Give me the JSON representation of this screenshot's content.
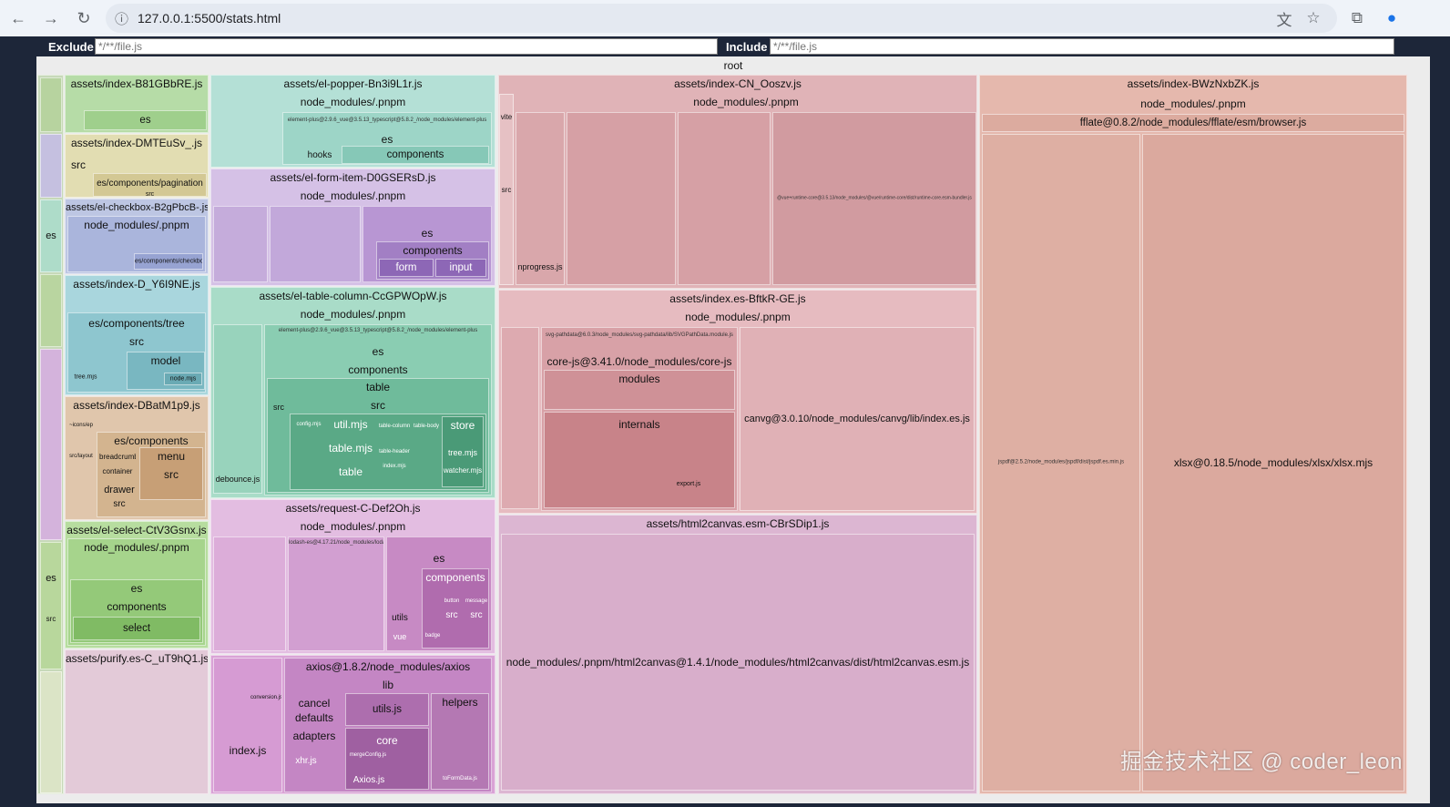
{
  "browser": {
    "url": "127.0.0.1:5500/stats.html",
    "back_icon": "←",
    "forward_icon": "→",
    "reload_icon": "↻",
    "info_icon": "ⓘ",
    "translate_icon": "文",
    "star_icon": "☆",
    "extensions_icon": "⧉",
    "profile_icon": "●"
  },
  "filters": {
    "exclude_label": "Exclude",
    "exclude_placeholder": "*/**/file.js",
    "include_label": "Include",
    "include_placeholder": "*/**/file.js"
  },
  "treemap": {
    "root": "root",
    "col1": {
      "b81": "assets/index-B81GBbRE.js",
      "b81_es": "es",
      "dmt": "assets/index-DMTEuSv_.js",
      "dmt_src": "src",
      "dmt_pag": "es/components/pagination",
      "dmt_pag_src": "src",
      "chk": "assets/el-checkbox-B2gPbcB-.js",
      "chk_nm": "node_modules/.pnpm",
      "chk_es": "es/components/checkbox",
      "chk_left_es": "es",
      "y6": "assets/index-D_Y6I9NE.js",
      "y6_tree": "es/components/tree",
      "y6_src": "src",
      "y6_model": "model",
      "y6_treemjs": "tree.mjs",
      "y6_node": "node.mjs",
      "dbat": "assets/index-DBatM1p9.js",
      "dbat_icons": "~icons/ep",
      "dbat_layout": "src/layout",
      "dbat_comps": "es/components",
      "dbat_bread": "breadcrumb",
      "dbat_menu": "menu",
      "dbat_container": "container",
      "dbat_src": "src",
      "dbat_drawer": "drawer",
      "dbat_drawer_src": "src",
      "sel": "assets/el-select-CtV3Gsnx.js",
      "sel_nm": "node_modules/.pnpm",
      "sel_es": "es",
      "sel_comps": "components",
      "sel_select": "select",
      "sel_left_es": "es",
      "sel_left_src": "src",
      "purify": "assets/purify.es-C_uT9hQ1.js"
    },
    "col2": {
      "popper": "assets/el-popper-Bn3i9L1r.js",
      "popper_nm": "node_modules/.pnpm",
      "popper_ep": "element-plus@2.9.6_vue@3.5.13_typescript@5.8.2_/node_modules/element-plus",
      "popper_es": "es",
      "popper_hooks": "hooks",
      "popper_comps": "components",
      "form": "assets/el-form-item-D0GSERsD.js",
      "form_nm": "node_modules/.pnpm",
      "form_es": "es",
      "form_comps": "components",
      "form_form": "form",
      "form_input": "input",
      "table": "assets/el-table-column-CcGPWOpW.js",
      "table_nm": "node_modules/.pnpm",
      "table_ep": "element-plus@2.9.6_vue@3.5.13_typescript@5.8.2_/node_modules/element-plus",
      "table_es": "es",
      "table_comps": "components",
      "table_table": "table",
      "table_src": "src",
      "table_src_left": "src",
      "table_util": "util.mjs",
      "table_tablemjs": "table.mjs",
      "table_table2": "table",
      "table_column": "table-column",
      "table_body": "table-body",
      "table_header": "table-header",
      "table_store": "store",
      "table_treemjs": "tree.mjs",
      "table_watcher": "watcher.mjs",
      "table_config": "config.mjs",
      "table_index": "index.mjs",
      "table_debounce": "debounce.js",
      "request": "assets/request-C-Def2Oh.js",
      "request_nm": "node_modules/.pnpm",
      "request_lodash": "lodash-es@4.17.21/node_modules/lodash-es",
      "request_es": "es",
      "request_comps": "components",
      "request_utils": "utils",
      "request_vue": "vue",
      "request_button": "button",
      "request_message": "message",
      "request_src": "src",
      "request_src2": "src",
      "request_badge": "badge",
      "axios": "axios@1.8.2/node_modules/axios",
      "axios_lib": "lib",
      "axios_cancel": "cancel",
      "axios_defaults": "defaults",
      "axios_adapters": "adapters",
      "axios_utils": "utils.js",
      "axios_helpers": "helpers",
      "axios_core": "core",
      "axios_xhr": "xhr.js",
      "axios_axiosjs": "Axios.js",
      "axios_index": "index.js",
      "axios_conversion": "conversion.js",
      "axios_toform": "toFormData.js",
      "axios_merge": "mergeConfig.js"
    },
    "col3": {
      "cn": "assets/index-CN_Ooszv.js",
      "cn_nm": "node_modules/.pnpm",
      "cn_vite": "vite",
      "cn_src": "src",
      "cn_nprogress": "nprogress.js",
      "cn_vue": "@vue+runtime-core@3.5.13/node_modules/@vue/runtime-core/dist/runtime-core.esm-bundler.js",
      "bft": "assets/index.es-BftkR-GE.js",
      "bft_nm": "node_modules/.pnpm",
      "bft_svg": "svg-pathdata@6.0.3/node_modules/svg-pathdata/lib/SVGPathData.module.js",
      "bft_corejs": "core-js@3.41.0/node_modules/core-js",
      "bft_modules": "modules",
      "bft_internals": "internals",
      "bft_export": "export.js",
      "bft_canvg": "canvg@3.0.10/node_modules/canvg/lib/index.es.js",
      "h2c": "assets/html2canvas.esm-CBrSDip1.js",
      "h2c_path": "node_modules/.pnpm/html2canvas@1.4.1/node_modules/html2canvas/dist/html2canvas.esm.js"
    },
    "col4": {
      "bwz": "assets/index-BWzNxbZK.js",
      "bwz_nm": "node_modules/.pnpm",
      "bwz_fflate": "fflate@0.8.2/node_modules/fflate/esm/browser.js",
      "bwz_jspdf": "jspdf@2.5.2/node_modules/jspdf/dist/jspdf.es.min.js",
      "bwz_xlsx": "xlsx@0.18.5/node_modules/xlsx/xlsx.mjs"
    }
  },
  "watermark": "掘金技术社区 @ coder_leon",
  "colors": {
    "green": "#a9d49c",
    "teal": "#a7dccd",
    "purple": "#c9a8d6",
    "pink": "#dca2cf",
    "rose": "#d9a3a5",
    "salmon": "#dda9a0"
  }
}
